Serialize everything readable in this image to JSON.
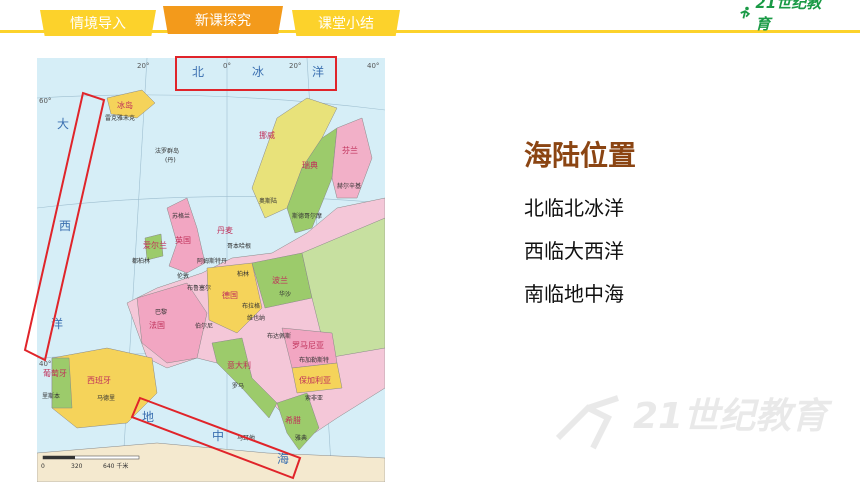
{
  "tabs": [
    {
      "label": "情境导入"
    },
    {
      "label": "新课探究"
    },
    {
      "label": "课堂小结"
    }
  ],
  "brand": {
    "logo_text": "21世纪教育",
    "watermark_text": "21世纪教育",
    "color": "#1a9a46"
  },
  "map": {
    "sea_labels": [
      "北",
      "冰",
      "洋",
      "大",
      "西",
      "洋",
      "地",
      "中",
      "海"
    ],
    "country_labels": [
      "冰岛",
      "挪威",
      "瑞典",
      "芬兰",
      "英国",
      "爱尔兰",
      "法国",
      "德国",
      "波兰",
      "西班牙",
      "葡萄牙",
      "意大利",
      "罗马尼亚",
      "保加利亚",
      "丹麦",
      "希腊"
    ],
    "city_labels": [
      "雷克雅未克",
      "奥斯陆",
      "斯德哥尔摩",
      "赫尔辛基",
      "都柏林",
      "伦敦",
      "巴黎",
      "马德里",
      "里斯本",
      "罗马",
      "柏林",
      "华沙",
      "维也纳",
      "布达佩斯",
      "布加勒斯特",
      "哥本哈根",
      "阿姆斯特丹",
      "布鲁塞尔",
      "伯尔尼",
      "雅典",
      "索非亚",
      "布拉格"
    ],
    "region_labels": [
      "法罗群岛",
      "(丹)",
      "苏格兰",
      "马耳他"
    ],
    "degree_labels": [
      "20°",
      "0°",
      "20°",
      "40°",
      "60°",
      "40°"
    ],
    "scale_ticks": [
      "0",
      "320",
      "640 千米"
    ]
  },
  "content": {
    "heading": "海陆位置",
    "lines": [
      "北临北冰洋",
      "西临大西洋",
      "南临地中海"
    ]
  },
  "colors": {
    "tab_active": "#f39a1b",
    "tab": "#fcd22b",
    "heading": "#8b4513",
    "highlight": "#e0242a"
  }
}
